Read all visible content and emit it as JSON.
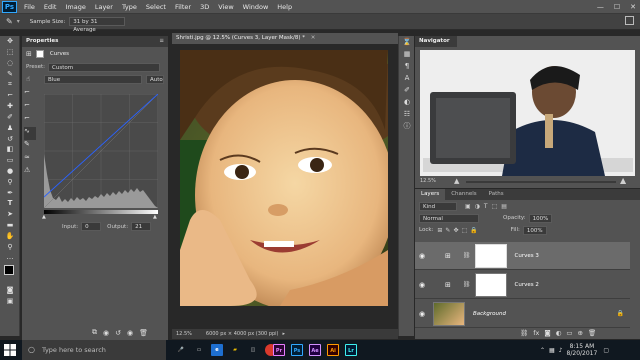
{
  "app": {
    "logo": "Ps"
  },
  "menu": [
    "File",
    "Edit",
    "Image",
    "Layer",
    "Type",
    "Select",
    "Filter",
    "3D",
    "View",
    "Window",
    "Help"
  ],
  "options_bar": {
    "sample_size_label": "Sample Size:",
    "sample_size_value": "31 by 31 Average"
  },
  "properties": {
    "panel_title": "Properties",
    "adjustment_name": "Curves",
    "preset_label": "Preset:",
    "preset_value": "Custom",
    "channel_value": "Blue",
    "auto_button": "Auto",
    "input_label": "Input:",
    "input_value": "0",
    "output_label": "Output:",
    "output_value": "21"
  },
  "document": {
    "tab_title": "Shristi.jpg @ 12.5% (Curves 3, Layer Mask/8) *",
    "zoom": "12.5%",
    "doc_size": "6000 px × 4000 px (300 ppi)"
  },
  "navigator": {
    "title": "Navigator",
    "zoom": "12.5%"
  },
  "layers_panel": {
    "tabs": [
      "Layers",
      "Channels",
      "Paths"
    ],
    "filter_value": "Kind",
    "blend_mode": "Normal",
    "opacity_label": "Opacity:",
    "opacity_value": "100%",
    "lock_label": "Lock:",
    "fill_label": "Fill:",
    "fill_value": "100%",
    "layers": [
      {
        "name": "Curves 3",
        "selected": true
      },
      {
        "name": "Curves 2",
        "selected": false
      },
      {
        "name": "Background",
        "selected": false
      }
    ]
  },
  "taskbar": {
    "search_placeholder": "Type here to search",
    "apps": [
      "Pr",
      "Ps",
      "Ae",
      "Ai",
      "Lr"
    ],
    "time": "8:15 AM",
    "date": "8/20/2017"
  },
  "colors": {
    "accent": "#31a8ff",
    "panel": "#535353",
    "dark": "#282828"
  }
}
